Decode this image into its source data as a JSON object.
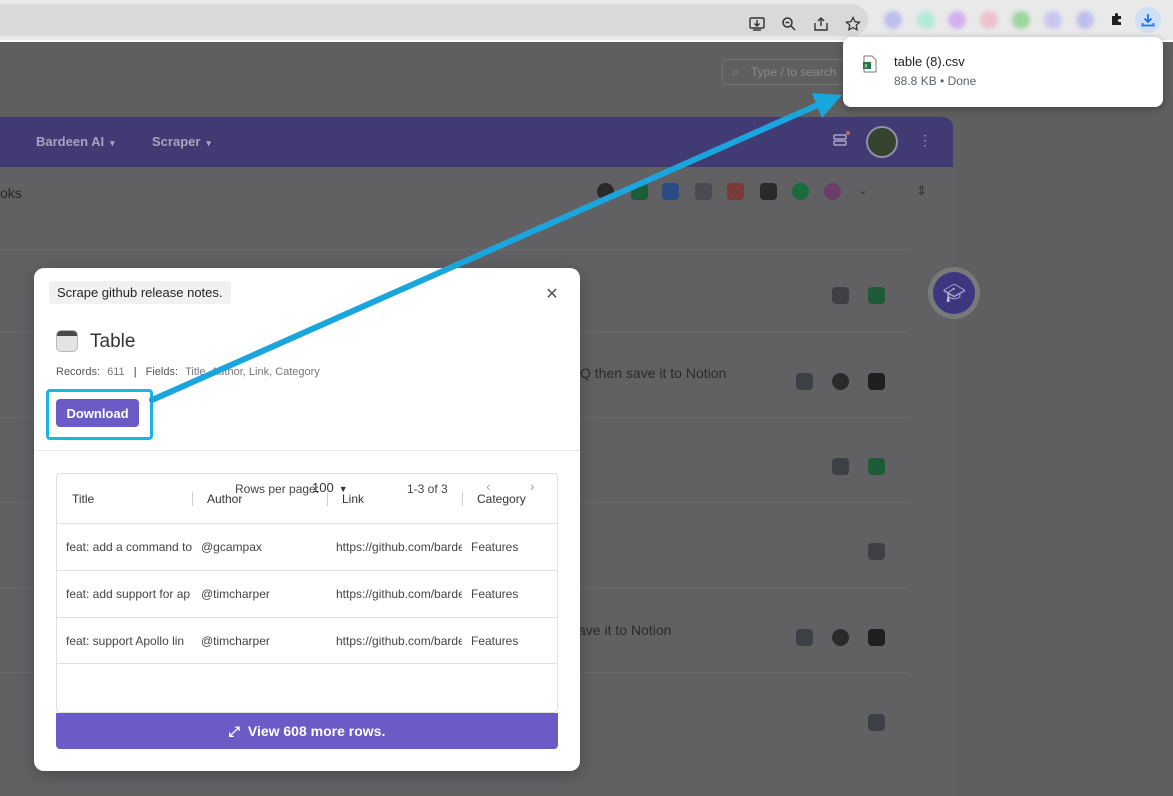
{
  "browser": {
    "search_placeholder": "Type / to search",
    "download_popup": {
      "file_name": "table (8).csv",
      "status": "88.8 KB • Done"
    }
  },
  "panel": {
    "nav": [
      {
        "label": "Bardeen AI"
      },
      {
        "label": "Scraper"
      }
    ],
    "subhead_fragment": "oks",
    "rows": [
      {
        "text_fragment": "Q then save it to Notion"
      },
      {
        "text_fragment": "ave it to Notion"
      }
    ]
  },
  "modal": {
    "tag": "Scrape github release notes.",
    "title": "Table",
    "records_label": "Records:",
    "records_value": "611",
    "fields_label": "Fields:",
    "fields_value": "Title, Author, Link, Category",
    "download_label": "Download",
    "table": {
      "headers": [
        "Title",
        "Author",
        "Link",
        "Category"
      ],
      "rows": [
        [
          "feat: add a command to",
          "@gcampax",
          "https://github.com/bardeen",
          "Features"
        ],
        [
          "feat: add support for ap",
          "@timcharper",
          "https://github.com/bardeen",
          "Features"
        ],
        [
          "feat: support Apollo lin",
          "@timcharper",
          "https://github.com/bardeen",
          "Features"
        ]
      ]
    },
    "pager": {
      "rows_per_page_label": "Rows per page:",
      "rows_per_page_value": "100",
      "range": "1-3 of 3"
    },
    "view_more_label": "View 608 more rows."
  },
  "colors": {
    "accent": "#6b5bc6",
    "highlight": "#1ab4e8"
  }
}
